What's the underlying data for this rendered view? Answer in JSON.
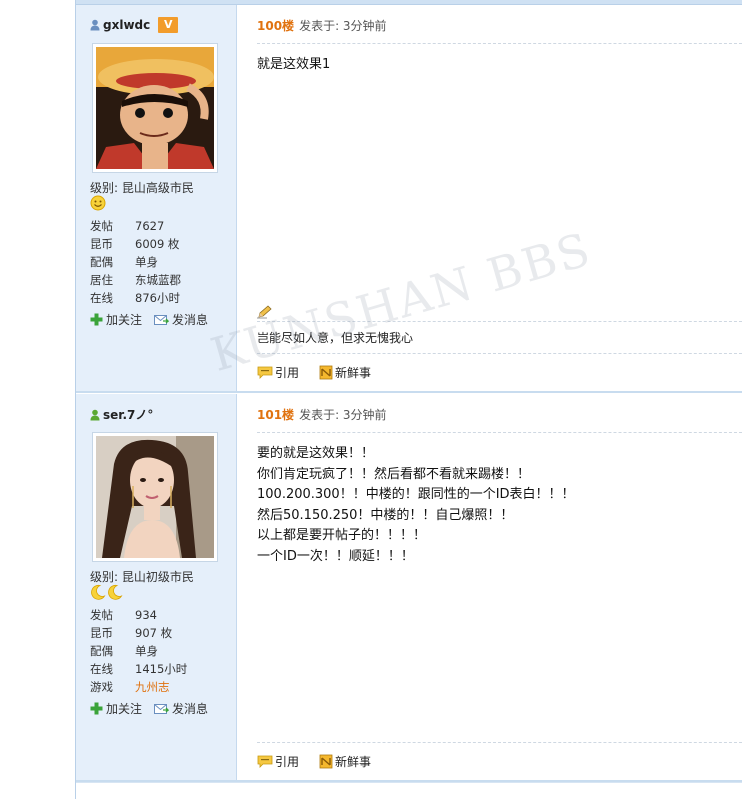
{
  "posts": [
    {
      "username": "gxlwdc",
      "vip_badge": "V",
      "level": "级别: 昆山高级市民",
      "stats": [
        {
          "label": "发帖",
          "value": "7627"
        },
        {
          "label": "昆币",
          "value": "6009 枚"
        },
        {
          "label": "配偶",
          "value": "单身"
        },
        {
          "label": "居住",
          "value": "东城蓝郡"
        },
        {
          "label": "在线",
          "value": "876小时"
        }
      ],
      "follow_label": "加关注",
      "message_label": "发消息",
      "floor": "100楼",
      "posted_at": "发表于: 3分钟前",
      "body": [
        "就是这效果1"
      ],
      "signature": "岂能尽如人意，但求无愧我心",
      "quote_label": "引用",
      "fresh_label": "新鲜事"
    },
    {
      "username": "ser.7ノ°",
      "level": "级别: 昆山初级市民",
      "stats": [
        {
          "label": "发帖",
          "value": "934"
        },
        {
          "label": "昆币",
          "value": "907 枚"
        },
        {
          "label": "配偶",
          "value": "单身"
        },
        {
          "label": "在线",
          "value": "1415小时"
        },
        {
          "label": "游戏",
          "value": "九州志",
          "link": true
        }
      ],
      "follow_label": "加关注",
      "message_label": "发消息",
      "floor": "101楼",
      "posted_at": "发表于: 3分钟前",
      "body": [
        "要的就是这效果！！",
        "你们肯定玩疯了！！然后看都不看就来踢楼！！",
        "100.200.300！！中楼的！跟同性的一个ID表白！！！",
        "然后50.150.250！中楼的！！自己爆照！！",
        "以上都是要开帖子的！！！！",
        "一个ID一次！！顺延！！！"
      ],
      "quote_label": "引用",
      "fresh_label": "新鲜事"
    }
  ],
  "watermark": "KUNSHAN BBS",
  "colors": {
    "sidebar_bg": "#e5effa",
    "floor_orange": "#e0720f",
    "vip_orange": "#f29c2b",
    "border_blue": "#b9d0e8"
  },
  "icons": [
    "user-icon",
    "vip-badge",
    "smiley-icon",
    "moon-icon",
    "plus-icon",
    "message-icon",
    "pencil-icon",
    "quote-icon",
    "fresh-icon"
  ]
}
